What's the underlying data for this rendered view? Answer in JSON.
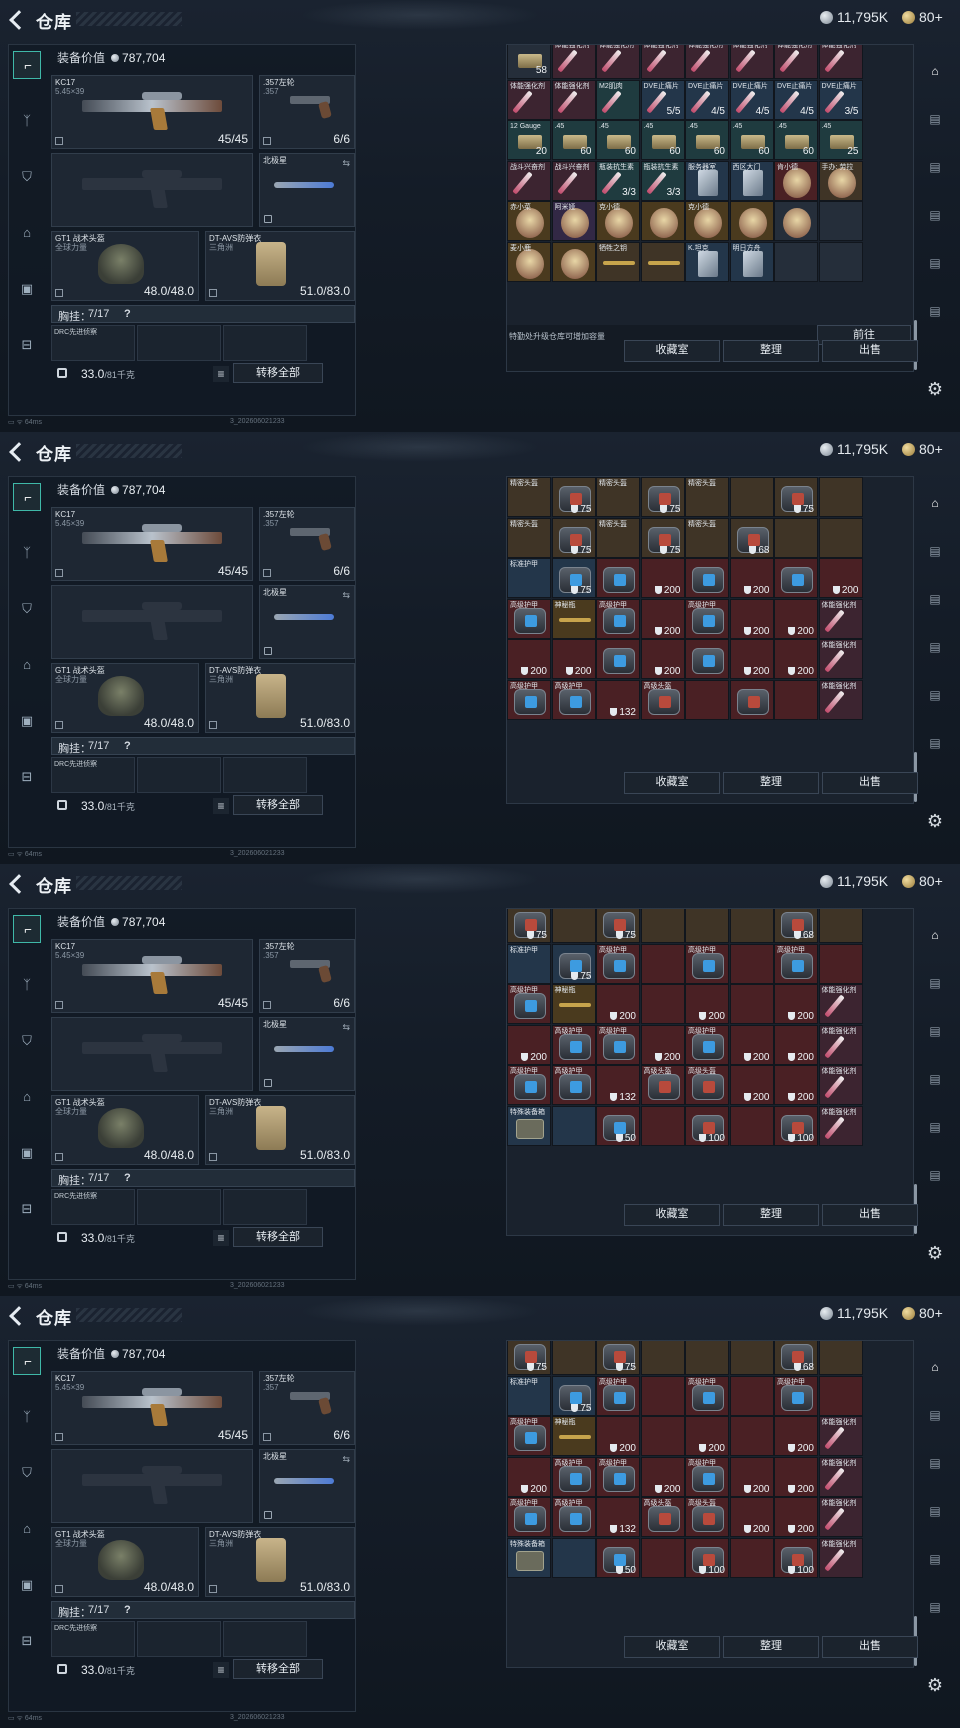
{
  "header": {
    "title": "仓库",
    "silver": "11,795K",
    "gold": "80+"
  },
  "equip": {
    "label": "装备价值",
    "value": "787,704",
    "primary": {
      "name": "KC17",
      "sub": "5.45×39",
      "count": "45/45"
    },
    "secondary": {
      "name": ".357左轮",
      "sub": ".357",
      "count": "6/6"
    },
    "melee": {
      "name": "北极星"
    },
    "helmet": {
      "name": "GT1 战术头盔",
      "sub": "全球力量",
      "count": "48.0/48.0"
    },
    "armor": {
      "name": "DT-AVS防弹衣",
      "sub": "三角洲",
      "count": "51.0/83.0"
    },
    "chest": {
      "label": "胸挂：",
      "count": "7/17",
      "help": "?"
    },
    "chest_item": "DRC先进侦察",
    "weight": "33.0",
    "weight_unit": "/81千克",
    "transfer": "转移全部",
    "list_icon": "≡"
  },
  "footer": {
    "ping": "64ms",
    "build": "3_202606021233"
  },
  "right": {
    "upgrade_tip": "特勤处升级仓库可增加容量",
    "goto": "前往",
    "collection": "收藏室",
    "sort": "整理",
    "sell": "出售"
  },
  "screens": [
    {
      "grid_mode": "consumables"
    },
    {
      "grid_mode": "armor_a"
    },
    {
      "grid_mode": "armor_b"
    },
    {
      "grid_mode": "armor_b"
    }
  ],
  "grid_consumables": [
    {
      "l": "",
      "v": "58",
      "c": "c-dark",
      "i": "ammo"
    },
    {
      "l": "体能强化剂",
      "v": "",
      "c": "c-pink",
      "i": "syringe"
    },
    {
      "l": "体能强化剂",
      "v": "",
      "c": "c-pink",
      "i": "syringe"
    },
    {
      "l": "体能强化剂",
      "v": "",
      "c": "c-pink",
      "i": "syringe"
    },
    {
      "l": "体能强化剂",
      "v": "",
      "c": "c-pink",
      "i": "syringe"
    },
    {
      "l": "体能强化剂",
      "v": "",
      "c": "c-pink",
      "i": "syringe"
    },
    {
      "l": "体能强化剂",
      "v": "",
      "c": "c-pink",
      "i": "syringe"
    },
    {
      "l": "体能强化剂",
      "v": "",
      "c": "c-pink",
      "i": "syringe"
    },
    {
      "l": "体能强化剂",
      "v": "",
      "c": "c-pink",
      "i": "syringe"
    },
    {
      "l": "体能强化剂",
      "v": "",
      "c": "c-pink",
      "i": "syringe"
    },
    {
      "l": "M2肌肉",
      "v": "",
      "c": "c-teal",
      "i": "syringe"
    },
    {
      "l": "DVE止痛片",
      "v": "5/5",
      "c": "c-blue",
      "i": "syringe"
    },
    {
      "l": "DVE止痛片",
      "v": "4/5",
      "c": "c-blue",
      "i": "syringe"
    },
    {
      "l": "DVE止痛片",
      "v": "4/5",
      "c": "c-blue",
      "i": "syringe"
    },
    {
      "l": "DVE止痛片",
      "v": "4/5",
      "c": "c-blue",
      "i": "syringe"
    },
    {
      "l": "DVE止痛片",
      "v": "3/5",
      "c": "c-blue",
      "i": "syringe"
    },
    {
      "l": "12 Gauge",
      "v": "20",
      "c": "c-teal",
      "i": "ammo"
    },
    {
      "l": ".45",
      "v": "60",
      "c": "c-teal",
      "i": "ammo"
    },
    {
      "l": ".45",
      "v": "60",
      "c": "c-teal",
      "i": "ammo"
    },
    {
      "l": ".45",
      "v": "60",
      "c": "c-teal",
      "i": "ammo"
    },
    {
      "l": ".45",
      "v": "60",
      "c": "c-teal",
      "i": "ammo"
    },
    {
      "l": ".45",
      "v": "60",
      "c": "c-teal",
      "i": "ammo"
    },
    {
      "l": ".45",
      "v": "60",
      "c": "c-teal",
      "i": "ammo"
    },
    {
      "l": ".45",
      "v": "25",
      "c": "c-teal",
      "i": "ammo"
    },
    {
      "l": "战斗兴奋剂",
      "v": "",
      "c": "c-pink",
      "i": "syringe"
    },
    {
      "l": "战斗兴奋剂",
      "v": "",
      "c": "c-pink",
      "i": "syringe"
    },
    {
      "l": "瓶装抗生素",
      "v": "3/3",
      "c": "c-teal",
      "i": "syringe"
    },
    {
      "l": "瓶装抗生素",
      "v": "3/3",
      "c": "c-teal",
      "i": "syringe"
    },
    {
      "l": "服务器室",
      "v": "",
      "c": "c-blue",
      "i": "card"
    },
    {
      "l": "西区大门",
      "v": "",
      "c": "c-blue",
      "i": "card"
    },
    {
      "l": "肯小德",
      "v": "",
      "c": "c-red",
      "i": "figure"
    },
    {
      "l": "手办: 劳拉",
      "v": "",
      "c": "c-brown",
      "i": "figure"
    },
    {
      "l": "赤小菜",
      "v": "",
      "c": "c-gold",
      "i": "figure"
    },
    {
      "l": "阿米娅",
      "v": "",
      "c": "c-purple",
      "i": "figure"
    },
    {
      "l": "克小德",
      "v": "",
      "c": "c-gold",
      "i": "figure"
    },
    {
      "l": "",
      "v": "",
      "c": "c-gold",
      "i": "figure"
    },
    {
      "l": "克小德",
      "v": "",
      "c": "c-gold",
      "i": "figure"
    },
    {
      "l": "",
      "v": "",
      "c": "c-gold",
      "i": "figure"
    },
    {
      "l": "",
      "v": "",
      "c": "c-dark",
      "i": "figure"
    },
    {
      "l": "",
      "v": "",
      "c": "c-dark",
      "i": ""
    },
    {
      "l": "麦小鹿",
      "v": "",
      "c": "c-gold",
      "i": "figure"
    },
    {
      "l": "",
      "v": "",
      "c": "c-gold",
      "i": "figure"
    },
    {
      "l": "牺牲之钥",
      "v": "",
      "c": "c-brown",
      "i": "key"
    },
    {
      "l": "",
      "v": "",
      "c": "c-brown",
      "i": "key"
    },
    {
      "l": "K.坦克",
      "v": "",
      "c": "c-blue",
      "i": "card"
    },
    {
      "l": "明日方舟",
      "v": "",
      "c": "c-blue",
      "i": "card"
    },
    {
      "l": "",
      "v": "",
      "c": "c-dark",
      "i": ""
    },
    {
      "l": "",
      "v": "",
      "c": "c-dark",
      "i": ""
    }
  ],
  "grid_armor_a": [
    {
      "l": "精密头盔",
      "v": "",
      "c": "c-brown",
      "i": ""
    },
    {
      "l": "",
      "v": "75",
      "c": "c-brown",
      "i": "bagred"
    },
    {
      "l": "精密头盔",
      "v": "",
      "c": "c-brown",
      "i": ""
    },
    {
      "l": "",
      "v": "75",
      "c": "c-brown",
      "i": "bagred"
    },
    {
      "l": "精密头盔",
      "v": "",
      "c": "c-brown",
      "i": ""
    },
    {
      "l": "",
      "v": "",
      "c": "c-brown",
      "i": ""
    },
    {
      "l": "",
      "v": "75",
      "c": "c-brown",
      "i": "bagred"
    },
    {
      "l": "",
      "v": "",
      "c": "c-brown",
      "i": ""
    },
    {
      "l": "精密头盔",
      "v": "",
      "c": "c-brown",
      "i": ""
    },
    {
      "l": "",
      "v": "75",
      "c": "c-brown",
      "i": "bagred"
    },
    {
      "l": "精密头盔",
      "v": "",
      "c": "c-brown",
      "i": ""
    },
    {
      "l": "",
      "v": "75",
      "c": "c-brown",
      "i": "bagred"
    },
    {
      "l": "精密头盔",
      "v": "",
      "c": "c-brown",
      "i": ""
    },
    {
      "l": "",
      "v": "68",
      "c": "c-brown",
      "i": "bagred"
    },
    {
      "l": "",
      "v": "",
      "c": "c-brown",
      "i": ""
    },
    {
      "l": "",
      "v": "",
      "c": "c-brown",
      "i": ""
    },
    {
      "l": "标准护甲",
      "v": "",
      "c": "c-blue",
      "i": ""
    },
    {
      "l": "",
      "v": "75",
      "c": "c-blue",
      "i": "bag"
    },
    {
      "l": "",
      "v": "",
      "c": "c-red",
      "i": "bag"
    },
    {
      "l": "",
      "v": "200",
      "c": "c-red",
      "i": ""
    },
    {
      "l": "",
      "v": "",
      "c": "c-red",
      "i": "bag"
    },
    {
      "l": "",
      "v": "200",
      "c": "c-red",
      "i": ""
    },
    {
      "l": "",
      "v": "",
      "c": "c-red",
      "i": "bag"
    },
    {
      "l": "",
      "v": "200",
      "c": "c-red",
      "i": ""
    },
    {
      "l": "高级护甲",
      "v": "",
      "c": "c-red",
      "i": "bag"
    },
    {
      "l": "神秘瓶",
      "v": "",
      "c": "c-gold",
      "i": "key"
    },
    {
      "l": "高级护甲",
      "v": "",
      "c": "c-red",
      "i": "bag"
    },
    {
      "l": "",
      "v": "200",
      "c": "c-red",
      "i": ""
    },
    {
      "l": "高级护甲",
      "v": "",
      "c": "c-red",
      "i": "bag"
    },
    {
      "l": "",
      "v": "200",
      "c": "c-red",
      "i": ""
    },
    {
      "l": "",
      "v": "200",
      "c": "c-red",
      "i": ""
    },
    {
      "l": "体能强化剂",
      "v": "",
      "c": "c-pink",
      "i": "syringe"
    },
    {
      "l": "",
      "v": "200",
      "c": "c-red",
      "i": ""
    },
    {
      "l": "",
      "v": "200",
      "c": "c-red",
      "i": ""
    },
    {
      "l": "",
      "v": "",
      "c": "c-red",
      "i": "bag"
    },
    {
      "l": "",
      "v": "200",
      "c": "c-red",
      "i": ""
    },
    {
      "l": "",
      "v": "",
      "c": "c-red",
      "i": "bag"
    },
    {
      "l": "",
      "v": "200",
      "c": "c-red",
      "i": ""
    },
    {
      "l": "",
      "v": "200",
      "c": "c-red",
      "i": ""
    },
    {
      "l": "体能强化剂",
      "v": "",
      "c": "c-pink",
      "i": "syringe"
    },
    {
      "l": "高级护甲",
      "v": "",
      "c": "c-red",
      "i": "bag"
    },
    {
      "l": "高级护甲",
      "v": "",
      "c": "c-red",
      "i": "bag"
    },
    {
      "l": "",
      "v": "132",
      "c": "c-red",
      "i": ""
    },
    {
      "l": "高级头盔",
      "v": "",
      "c": "c-red",
      "i": "bagred"
    },
    {
      "l": "",
      "v": "",
      "c": "c-red",
      "i": ""
    },
    {
      "l": "",
      "v": "",
      "c": "c-red",
      "i": "bagred"
    },
    {
      "l": "",
      "v": "",
      "c": "c-red",
      "i": ""
    },
    {
      "l": "体能强化剂",
      "v": "",
      "c": "c-pink",
      "i": "syringe"
    }
  ],
  "grid_armor_b": [
    {
      "l": "",
      "v": "75",
      "c": "c-brown",
      "i": "bagred"
    },
    {
      "l": "",
      "v": "",
      "c": "c-brown",
      "i": ""
    },
    {
      "l": "",
      "v": "75",
      "c": "c-brown",
      "i": "bagred"
    },
    {
      "l": "",
      "v": "",
      "c": "c-brown",
      "i": ""
    },
    {
      "l": "",
      "v": "",
      "c": "c-brown",
      "i": ""
    },
    {
      "l": "",
      "v": "",
      "c": "c-brown",
      "i": ""
    },
    {
      "l": "",
      "v": "68",
      "c": "c-brown",
      "i": "bagred"
    },
    {
      "l": "",
      "v": "",
      "c": "c-brown",
      "i": ""
    },
    {
      "l": "标准护甲",
      "v": "",
      "c": "c-blue",
      "i": ""
    },
    {
      "l": "",
      "v": "75",
      "c": "c-blue",
      "i": "bag"
    },
    {
      "l": "高级护甲",
      "v": "",
      "c": "c-red",
      "i": "bag"
    },
    {
      "l": "",
      "v": "",
      "c": "c-red",
      "i": ""
    },
    {
      "l": "高级护甲",
      "v": "",
      "c": "c-red",
      "i": "bag"
    },
    {
      "l": "",
      "v": "",
      "c": "c-red",
      "i": ""
    },
    {
      "l": "高级护甲",
      "v": "",
      "c": "c-red",
      "i": "bag"
    },
    {
      "l": "",
      "v": "",
      "c": "c-red",
      "i": ""
    },
    {
      "l": "高级护甲",
      "v": "",
      "c": "c-red",
      "i": "bag"
    },
    {
      "l": "神秘瓶",
      "v": "",
      "c": "c-gold",
      "i": "key"
    },
    {
      "l": "",
      "v": "200",
      "c": "c-red",
      "i": ""
    },
    {
      "l": "",
      "v": "",
      "c": "c-red",
      "i": ""
    },
    {
      "l": "",
      "v": "200",
      "c": "c-red",
      "i": ""
    },
    {
      "l": "",
      "v": "",
      "c": "c-red",
      "i": ""
    },
    {
      "l": "",
      "v": "200",
      "c": "c-red",
      "i": ""
    },
    {
      "l": "体能强化剂",
      "v": "",
      "c": "c-pink",
      "i": "syringe"
    },
    {
      "l": "",
      "v": "200",
      "c": "c-red",
      "i": ""
    },
    {
      "l": "高级护甲",
      "v": "",
      "c": "c-red",
      "i": "bag"
    },
    {
      "l": "高级护甲",
      "v": "",
      "c": "c-red",
      "i": "bag"
    },
    {
      "l": "",
      "v": "200",
      "c": "c-red",
      "i": ""
    },
    {
      "l": "高级护甲",
      "v": "",
      "c": "c-red",
      "i": "bag"
    },
    {
      "l": "",
      "v": "200",
      "c": "c-red",
      "i": ""
    },
    {
      "l": "",
      "v": "200",
      "c": "c-red",
      "i": ""
    },
    {
      "l": "体能强化剂",
      "v": "",
      "c": "c-pink",
      "i": "syringe"
    },
    {
      "l": "高级护甲",
      "v": "",
      "c": "c-red",
      "i": "bag"
    },
    {
      "l": "高级护甲",
      "v": "",
      "c": "c-red",
      "i": "bag"
    },
    {
      "l": "",
      "v": "132",
      "c": "c-red",
      "i": ""
    },
    {
      "l": "高级头盔",
      "v": "",
      "c": "c-red",
      "i": "bagred"
    },
    {
      "l": "高级头盔",
      "v": "",
      "c": "c-red",
      "i": "bagred"
    },
    {
      "l": "",
      "v": "200",
      "c": "c-red",
      "i": ""
    },
    {
      "l": "",
      "v": "200",
      "c": "c-red",
      "i": ""
    },
    {
      "l": "体能强化剂",
      "v": "",
      "c": "c-pink",
      "i": "syringe"
    },
    {
      "l": "特殊装备箱",
      "v": "",
      "c": "c-blue",
      "i": "case"
    },
    {
      "l": "",
      "v": "",
      "c": "c-blue",
      "i": ""
    },
    {
      "l": "",
      "v": "50",
      "c": "c-red",
      "i": "bag"
    },
    {
      "l": "",
      "v": "",
      "c": "c-red",
      "i": ""
    },
    {
      "l": "",
      "v": "100",
      "c": "c-red",
      "i": "bagred"
    },
    {
      "l": "",
      "v": "",
      "c": "c-red",
      "i": ""
    },
    {
      "l": "",
      "v": "100",
      "c": "c-red",
      "i": "bagred"
    },
    {
      "l": "体能强化剂",
      "v": "",
      "c": "c-pink",
      "i": "syringe"
    }
  ],
  "rail_icons": [
    "backpack-icon",
    "weapon-icon",
    "case-icon",
    "case-icon",
    "case-icon",
    "case-icon",
    "case-icon",
    "case-icon"
  ],
  "side_icons": [
    "gun-tab-icon",
    "vest-tab-icon",
    "armor-tab-icon",
    "bag-tab-icon",
    "case-tab-icon",
    "toolbox-tab-icon"
  ]
}
